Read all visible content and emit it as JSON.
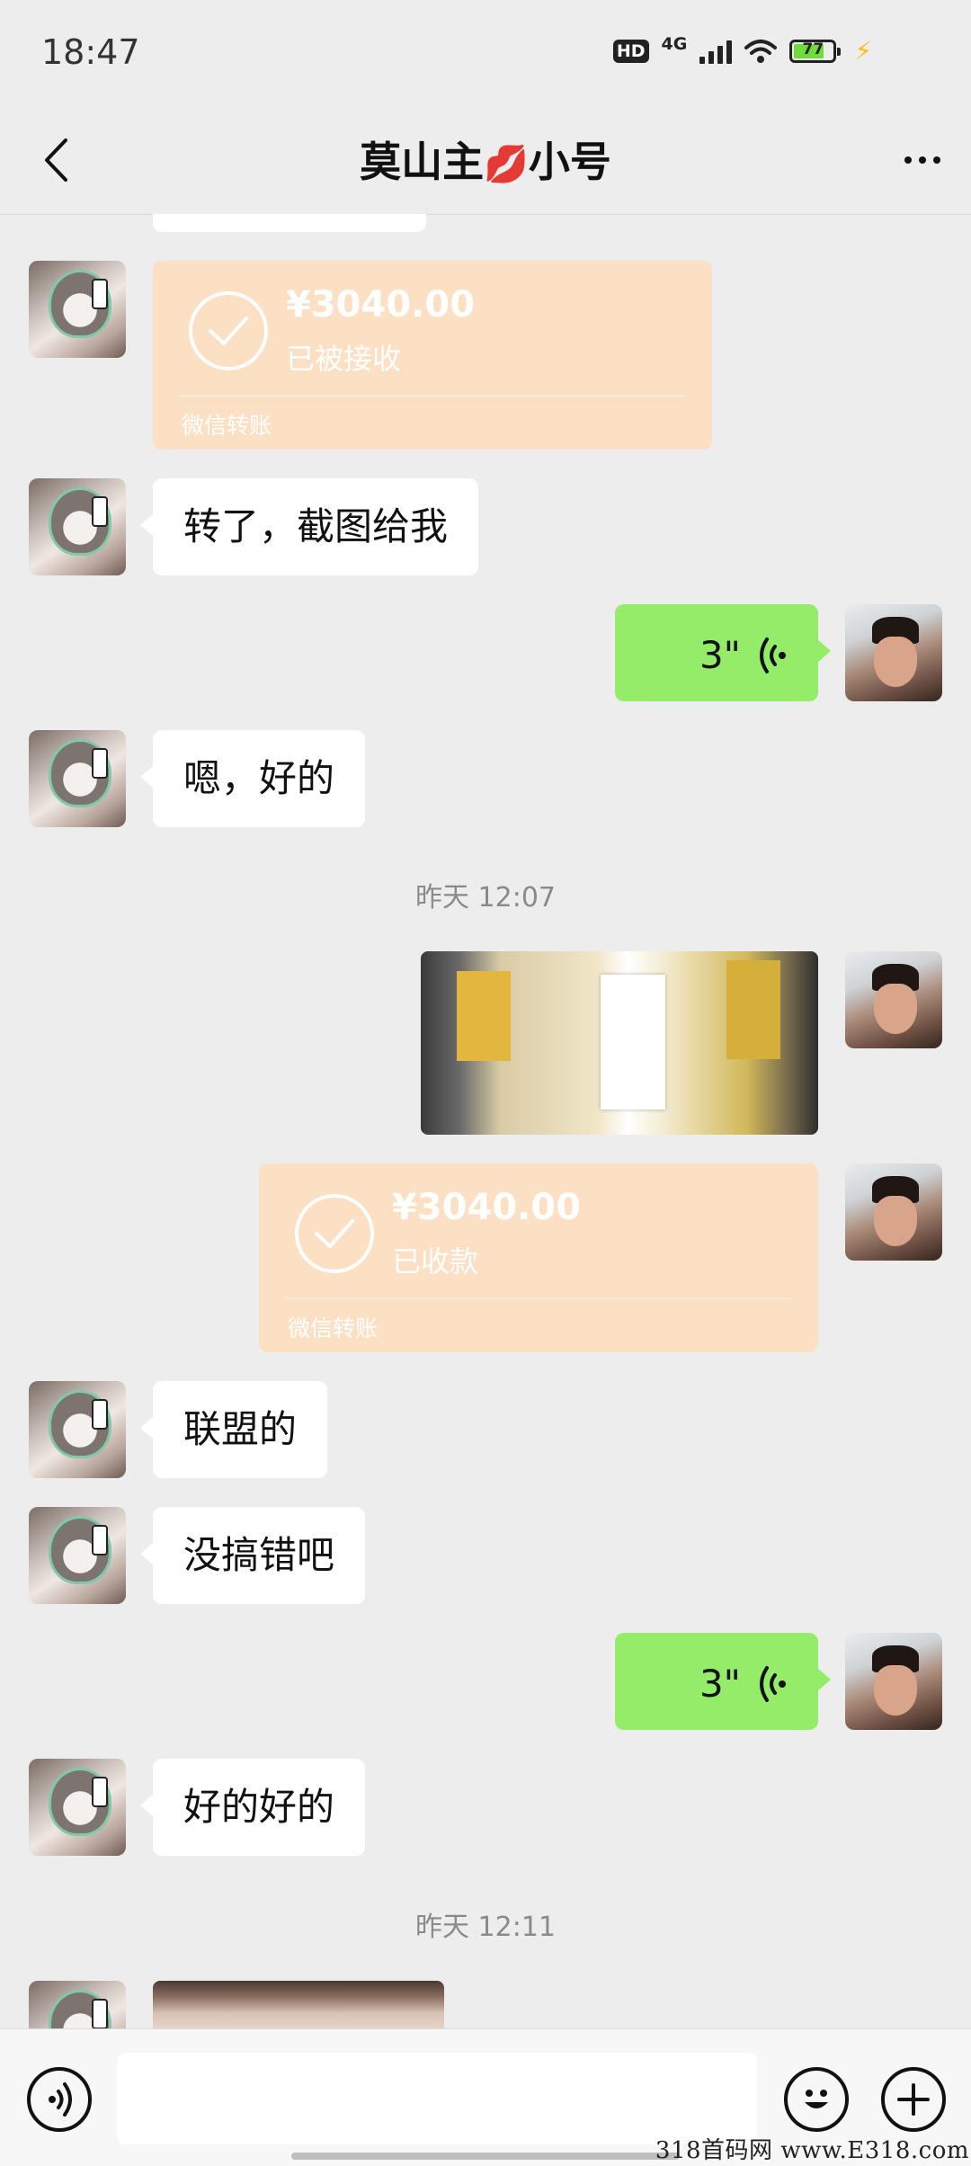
{
  "status_bar": {
    "time": "18:47",
    "hd_badge": "HD",
    "network": "4G",
    "battery": "77",
    "icons": [
      "signal-icon",
      "wifi-icon",
      "battery-icon",
      "charging-icon"
    ]
  },
  "header": {
    "title_part1": "莫山主",
    "title_emoji": "💋",
    "title_part2": "小号"
  },
  "messages": {
    "transfer1": {
      "amount": "¥3040.00",
      "status": "已被接收",
      "footer": "微信转账"
    },
    "text1": "转了，截图给我",
    "voice1": "3\"",
    "text2": "嗯，好的",
    "timestamp1": "昨天 12:07",
    "transfer2": {
      "amount": "¥3040.00",
      "status": "已收款",
      "footer": "微信转账"
    },
    "text3": "联盟的",
    "text4": "没搞错吧",
    "voice2": "3\"",
    "text5": "好的好的",
    "timestamp2": "昨天 12:11"
  },
  "input": {
    "placeholder": ""
  },
  "colors": {
    "background": "#EDEDED",
    "self_bubble": "#95EC69",
    "transfer": "#FCE0C3",
    "other_bubble": "#FFFFFF"
  },
  "watermark": "318首码网 www.E318.com"
}
